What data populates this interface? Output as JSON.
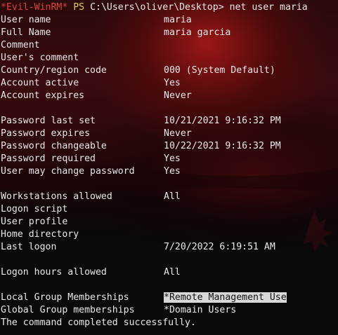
{
  "prompt": {
    "tag": "*Evil-WinRM*",
    "ps": "PS",
    "path": "C:\\Users\\oliver\\Desktop>",
    "command": "net user maria"
  },
  "rows": [
    {
      "label": "User name",
      "value": "maria"
    },
    {
      "label": "Full Name",
      "value": "maria garcia"
    },
    {
      "label": "Comment",
      "value": ""
    },
    {
      "label": "User's comment",
      "value": ""
    },
    {
      "label": "Country/region code",
      "value": "000 (System Default)"
    },
    {
      "label": "Account active",
      "value": "Yes"
    },
    {
      "label": "Account expires",
      "value": "Never"
    },
    {
      "label": "",
      "value": ""
    },
    {
      "label": "Password last set",
      "value": "10/21/2021 9:16:32 PM"
    },
    {
      "label": "Password expires",
      "value": "Never"
    },
    {
      "label": "Password changeable",
      "value": "10/22/2021 9:16:32 PM"
    },
    {
      "label": "Password required",
      "value": "Yes"
    },
    {
      "label": "User may change password",
      "value": "Yes"
    },
    {
      "label": "",
      "value": ""
    },
    {
      "label": "Workstations allowed",
      "value": "All"
    },
    {
      "label": "Logon script",
      "value": ""
    },
    {
      "label": "User profile",
      "value": ""
    },
    {
      "label": "Home directory",
      "value": ""
    },
    {
      "label": "Last logon",
      "value": "7/20/2022 6:19:51 AM"
    },
    {
      "label": "",
      "value": ""
    },
    {
      "label": "Logon hours allowed",
      "value": "All"
    },
    {
      "label": "",
      "value": ""
    },
    {
      "label": "Local Group Memberships",
      "value": "*Remote Management Use",
      "highlight": true
    },
    {
      "label": "Global Group memberships",
      "value": "*Domain Users"
    }
  ],
  "footer": "The command completed successfully.",
  "colors": {
    "prompt_tag": "#e0413a",
    "prompt_ps": "#e8d04a",
    "text": "#e8e8e8",
    "selection_bg": "#d8d8d8"
  }
}
